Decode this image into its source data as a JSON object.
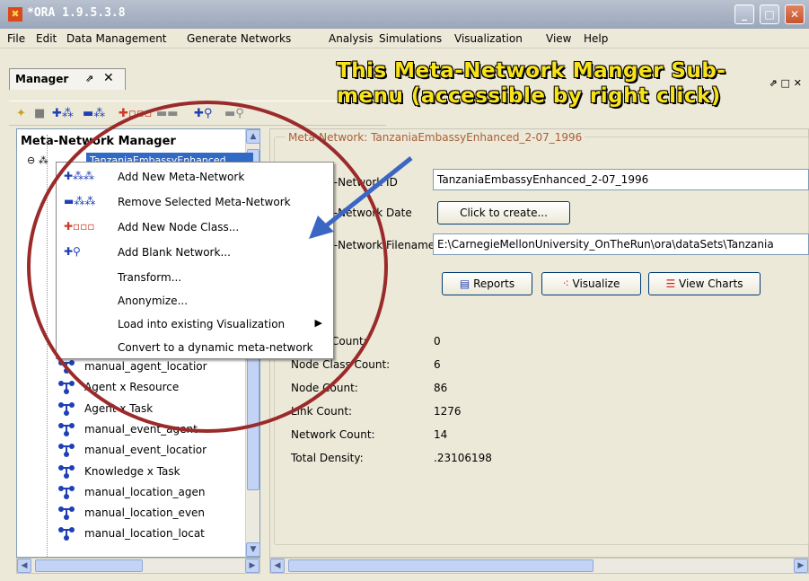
{
  "window": {
    "title": "*ORA 1.9.5.3.8",
    "icon": "ora-app-icon"
  },
  "menubar": [
    "File",
    "Edit",
    "Data Management",
    "Generate Networks",
    "Analysis",
    "Simulations",
    "Visualization",
    "View",
    "Help"
  ],
  "manager_panel": {
    "title": "Manager",
    "pin": "⇗",
    "close": "✕"
  },
  "tree": {
    "heading": "Meta-Network Manager",
    "root_label": "TanzaniaEmbassyEnhanced",
    "items": [
      "manual_agent_locatior",
      "Agent x Resource",
      "Agent x Task",
      "manual_event_agent",
      "manual_event_locatior",
      "Knowledge x Task",
      "manual_location_agen",
      "manual_location_even",
      "manual_location_locat"
    ]
  },
  "context_menu": {
    "items": [
      {
        "label": "Add New Meta-Network",
        "icon": "add-meta-network-icon"
      },
      {
        "label": "Remove Selected Meta-Network",
        "icon": "remove-meta-network-icon"
      },
      {
        "label": "Add New Node Class...",
        "icon": "add-node-class-icon"
      },
      {
        "label": "Add Blank Network...",
        "icon": "add-blank-network-icon"
      },
      {
        "label": "Transform..."
      },
      {
        "label": "Anonymize..."
      },
      {
        "label": "Load into existing Visualization",
        "submenu": true
      },
      {
        "label": "Convert to a dynamic meta-network"
      }
    ]
  },
  "details": {
    "group_title": "Meta-Network: TanzaniaEmbassyEnhanced_2-07_1996",
    "network_id_label": "Meta-Network ID",
    "network_id_value": "TanzaniaEmbassyEnhanced_2-07_1996",
    "date_label": "Meta-Network Date",
    "date_button": "Click to create...",
    "filename_label": "Meta-Network Filename",
    "filename_value": "E:\\CarnegieMellonUniversity_OnTheRun\\ora\\dataSets\\Tanzania",
    "buttons": {
      "reports": "Reports",
      "visualize": "Visualize",
      "view_charts": "View Charts"
    },
    "stats": [
      {
        "label": "Source Count:",
        "value": "0"
      },
      {
        "label": "Node Class Count:",
        "value": "6"
      },
      {
        "label": "Node Count:",
        "value": "86"
      },
      {
        "label": "Link Count:",
        "value": "1276"
      },
      {
        "label": "Network Count:",
        "value": "14"
      },
      {
        "label": "Total Density:",
        "value": ".23106198"
      }
    ]
  },
  "annotation": {
    "text": "This Meta-Network Manger Sub-menu (accessible by right click)",
    "circle_color": "#9b2b2b",
    "text_color": "#f8e21c",
    "arrow_color": "#3b66c4"
  }
}
